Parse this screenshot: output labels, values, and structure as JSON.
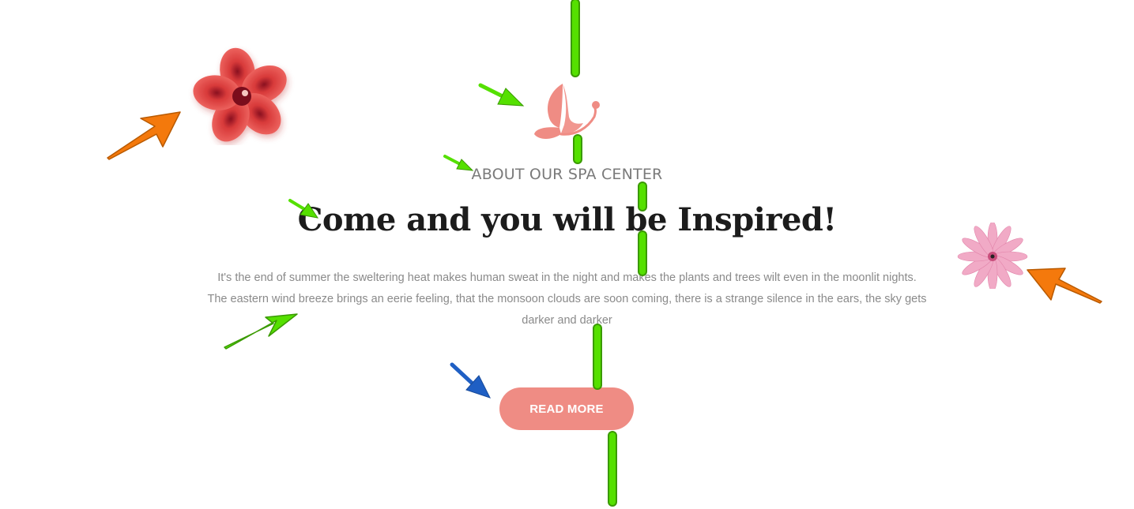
{
  "section": {
    "eyebrow": "ABOUT OUR SPA CENTER",
    "title": "Come and you will be Inspired!",
    "body_lines": [
      "It's the end of summer the sweltering heat makes human sweat in the night and makes the plants and trees wilt even in the moonlit nights.",
      "The eastern wind breeze brings an eerie feeling, that the monsoon clouds are soon coming, there is a strange silence in the ears, the sky gets",
      "darker and darker"
    ],
    "cta_label": "READ MORE"
  },
  "icons": {
    "logo": "butterfly-icon",
    "decor_left": "red-hibiscus-flower-icon",
    "decor_right": "pink-flower-icon"
  },
  "colors": {
    "accent": "#ef8c84",
    "title": "#1c1c1c",
    "eyebrow": "#7a7a7a",
    "body": "#8a8a8a",
    "annotation_green": "#55e000",
    "annotation_orange": "#f4790c",
    "annotation_blue": "#1f5fc4"
  }
}
